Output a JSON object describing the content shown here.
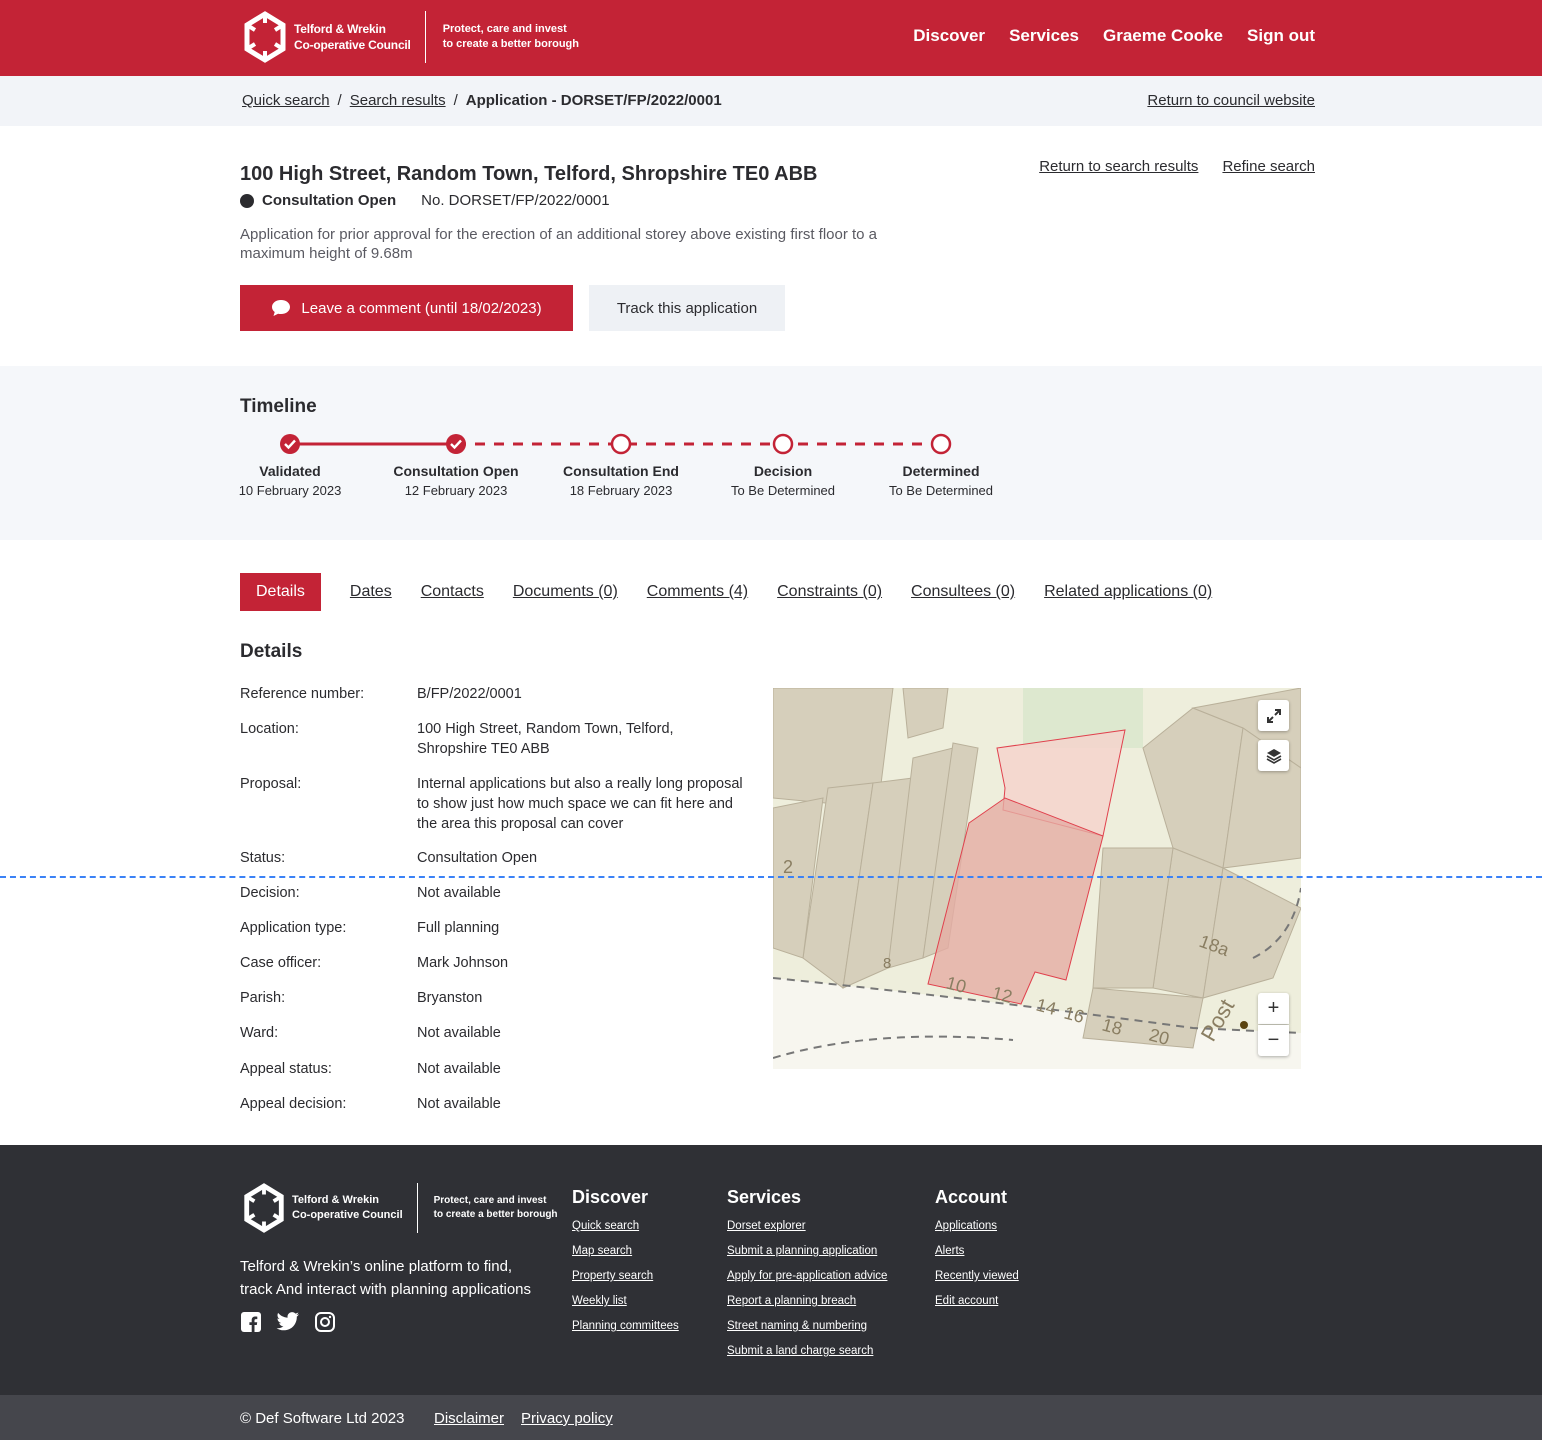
{
  "header": {
    "logo_line1": "Telford & Wrekin",
    "logo_line2": "Co-operative Council",
    "tagline_line1": "Protect, care and invest",
    "tagline_line2": "to create a better borough",
    "nav": [
      "Discover",
      "Services",
      "Graeme Cooke",
      "Sign out"
    ]
  },
  "breadcrumb": {
    "items": [
      "Quick search",
      "Search results"
    ],
    "current": "Application - DORSET/FP/2022/0001",
    "return_link": "Return to council website"
  },
  "application": {
    "address": "100 High Street, Random Town, Telford, Shropshire TE0 ABB",
    "status": "Consultation Open",
    "number": "No. DORSET/FP/2022/0001",
    "description": "Application for prior approval for the erection of an additional storey above existing first floor to a maximum height of 9.68m",
    "comment_button": "Leave a comment (until 18/02/2023)",
    "track_button": "Track this application",
    "return_results": "Return to search results",
    "refine_search": "Refine search"
  },
  "timeline": {
    "title": "Timeline",
    "steps": [
      {
        "label": "Validated",
        "date": "10 February 2023",
        "done": true
      },
      {
        "label": "Consultation Open",
        "date": "12 February 2023",
        "done": true
      },
      {
        "label": "Consultation End",
        "date": "18 February 2023",
        "done": false
      },
      {
        "label": "Decision",
        "date": "To Be Determined",
        "done": false
      },
      {
        "label": "Determined",
        "date": "To Be Determined",
        "done": false
      }
    ],
    "accent": "#c32336"
  },
  "tabs": [
    "Details",
    "Dates",
    "Contacts",
    "Documents (0)",
    "Comments (4)",
    "Constraints (0)",
    "Consultees (0)",
    "Related applications (0)"
  ],
  "details": {
    "heading": "Details",
    "rows": [
      {
        "key": "Reference number:",
        "value": "B/FP/2022/0001"
      },
      {
        "key": "Location:",
        "value": "100 High Street, Random Town, Telford, Shropshire TE0 ABB"
      },
      {
        "key": "Proposal:",
        "value": "Internal applications but also a really long proposal to show just how much space we can fit here and the area this proposal can cover"
      },
      {
        "key": "Status:",
        "value": "Consultation Open"
      },
      {
        "key": "Decision:",
        "value": "Not available"
      },
      {
        "key": "Application type:",
        "value": "Full planning"
      },
      {
        "key": "Case officer:",
        "value": "Mark Johnson"
      },
      {
        "key": "Parish:",
        "value": "Bryanston"
      },
      {
        "key": "Ward:",
        "value": "Not available"
      },
      {
        "key": "Appeal status:",
        "value": "Not available"
      },
      {
        "key": "Appeal decision:",
        "value": "Not available"
      }
    ]
  },
  "map": {
    "labels": [
      "2",
      "8",
      "10",
      "12",
      "14",
      "16",
      "18",
      "20",
      "18a",
      "Post"
    ],
    "zoom_in": "+",
    "zoom_out": "−"
  },
  "footer": {
    "logo_line1": "Telford & Wrekin",
    "logo_line2": "Co-operative Council",
    "tagline_line1": "Protect, care and invest",
    "tagline_line2": "to create a better borough",
    "description": "Telford & Wrekin’s online platform to find, track And interact with planning applications",
    "columns": [
      {
        "title": "Discover",
        "links": [
          "Quick search",
          "Map search",
          "Property search",
          "Weekly list",
          "Planning committees"
        ]
      },
      {
        "title": "Services",
        "links": [
          "Dorset explorer",
          "Submit a planning application",
          "Apply for pre-application advice",
          "Report a planning breach",
          "Street naming & numbering",
          "Submit a land charge search"
        ]
      },
      {
        "title": "Account",
        "links": [
          "Applications",
          "Alerts",
          "Recently viewed",
          "Edit account"
        ]
      }
    ],
    "copyright": "© Def Software Ltd 2023",
    "disclaimer": "Disclaimer",
    "privacy": "Privacy policy"
  }
}
